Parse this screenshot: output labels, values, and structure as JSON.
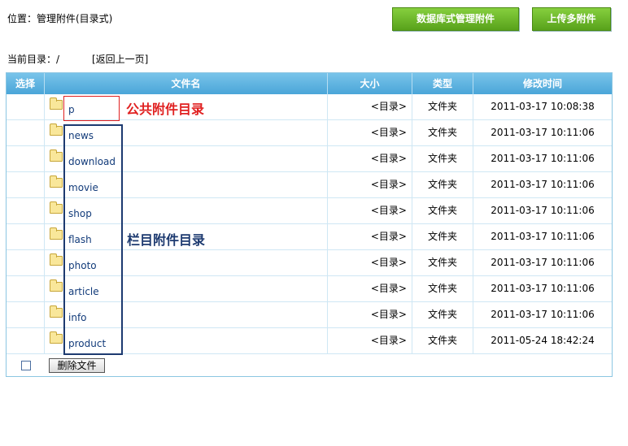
{
  "header": {
    "location": "位置：管理附件(目录式)",
    "db_button": "数据库式管理附件",
    "upload_button": "上传多附件"
  },
  "current_dir": {
    "label": "当前目录：/",
    "back_link": "[返回上一页]"
  },
  "table": {
    "columns": [
      "选择",
      "文件名",
      "大小",
      "类型",
      "修改时间"
    ],
    "rows": [
      {
        "name": "p",
        "size": "<目录>",
        "type": "文件夹",
        "modified": "2011-03-17 10:08:38"
      },
      {
        "name": "news",
        "size": "<目录>",
        "type": "文件夹",
        "modified": "2011-03-17 10:11:06"
      },
      {
        "name": "download",
        "size": "<目录>",
        "type": "文件夹",
        "modified": "2011-03-17 10:11:06"
      },
      {
        "name": "movie",
        "size": "<目录>",
        "type": "文件夹",
        "modified": "2011-03-17 10:11:06"
      },
      {
        "name": "shop",
        "size": "<目录>",
        "type": "文件夹",
        "modified": "2011-03-17 10:11:06"
      },
      {
        "name": "flash",
        "size": "<目录>",
        "type": "文件夹",
        "modified": "2011-03-17 10:11:06"
      },
      {
        "name": "photo",
        "size": "<目录>",
        "type": "文件夹",
        "modified": "2011-03-17 10:11:06"
      },
      {
        "name": "article",
        "size": "<目录>",
        "type": "文件夹",
        "modified": "2011-03-17 10:11:06"
      },
      {
        "name": "info",
        "size": "<目录>",
        "type": "文件夹",
        "modified": "2011-03-17 10:11:06"
      },
      {
        "name": "product",
        "size": "<目录>",
        "type": "文件夹",
        "modified": "2011-05-24 18:42:24"
      }
    ],
    "delete_button": "删除文件"
  },
  "annotations": {
    "public_label": "公共附件目录",
    "column_label": "栏目附件目录"
  },
  "colors": {
    "button_green": "#58a21b",
    "header_blue": "#4aa5d8",
    "annotation_red": "#e02020",
    "annotation_blue": "#1d3a70"
  },
  "icons": {
    "folder": "folder-icon"
  }
}
